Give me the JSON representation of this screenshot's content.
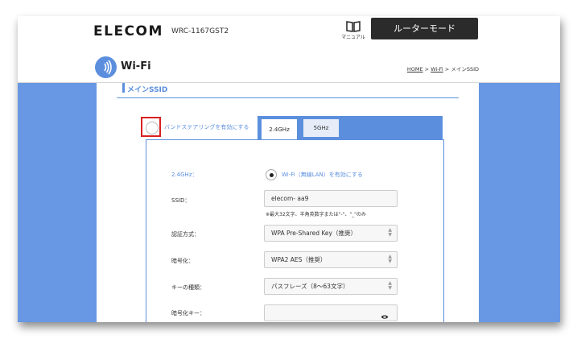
{
  "header": {
    "logo": "ELECOM",
    "model": "WRC-1167GST2",
    "manual_label": "マニュアル",
    "mode_button": "ルーターモード"
  },
  "titlebar": {
    "title": "Wi-Fi",
    "breadcrumb": {
      "home": "HOME",
      "sep1": " > ",
      "wifi": "Wi-Fi",
      "sep2": " > ",
      "current": "メインSSID"
    }
  },
  "section": {
    "title": "メインSSID"
  },
  "band_steering": {
    "label": "バンドステアリングを有効にする",
    "checked": false
  },
  "tabs": [
    {
      "label": "2.4GHz",
      "active": true
    },
    {
      "label": "5GHz",
      "active": false
    }
  ],
  "form": {
    "band_label": "2.4GHz：",
    "wifi_enable_label": "Wi-Fi（無線LAN）を有効にする",
    "ssid_label": "SSID：",
    "ssid_value": "elecom- aa9",
    "ssid_note": "※最大32文字、半角英数字または\"-\"、\"_\"のみ",
    "auth_label": "認証方式：",
    "auth_value": "WPA Pre-Shared Key（推奨）",
    "enc_label": "暗号化：",
    "enc_value": "WPA2 AES（推奨）",
    "keytype_label": "キーの種類：",
    "keytype_value": "パスフレーズ（8～63文字）",
    "key_label": "暗号化キー：",
    "key_value": ""
  },
  "colors": {
    "accent": "#5b8fde",
    "side": "#6897e3",
    "highlight": "#d92020",
    "button": "#2b2b2b"
  }
}
